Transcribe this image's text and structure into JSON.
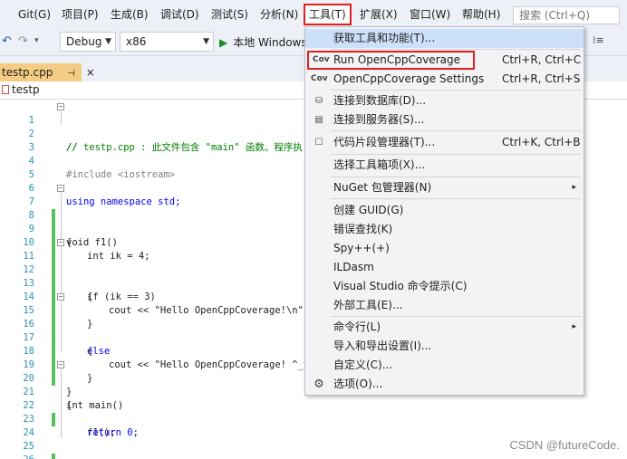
{
  "menubar": {
    "items": [
      "Git(G)",
      "项目(P)",
      "生成(B)",
      "调试(D)",
      "测试(S)",
      "分析(N)",
      "工具(T)",
      "扩展(X)",
      "窗口(W)",
      "帮助(H)"
    ],
    "search_placeholder": "搜索 (Ctrl+Q)"
  },
  "toolbar": {
    "config": "Debug",
    "platform": "x86",
    "run_label": "本地 Windows",
    "right_glyph": "⁞≡"
  },
  "tab": {
    "filename": "testp.cpp",
    "pin": "⊣",
    "close": "×"
  },
  "navbar": {
    "project": "testp"
  },
  "editor": {
    "lines": [
      {
        "n": "1",
        "text": "// testp.cpp : 此文件包含 \"main\" 函数。程序执"
      },
      {
        "n": "2",
        "text": "//"
      },
      {
        "n": "3",
        "text": ""
      },
      {
        "n": "4",
        "text": "#include <iostream>"
      },
      {
        "n": "5",
        "text": ""
      },
      {
        "n": "6",
        "text": "using namespace std;"
      },
      {
        "n": "7",
        "text": "void f1()"
      },
      {
        "n": "8",
        "text": "{"
      },
      {
        "n": "9",
        "text": "int ik = 4;"
      },
      {
        "n": "10",
        "text": ""
      },
      {
        "n": "11",
        "text": "if (ik == 3)"
      },
      {
        "n": "12",
        "text": "{"
      },
      {
        "n": "13",
        "text": "cout << \"Hello OpenCppCoverage!\\n\";"
      },
      {
        "n": "14",
        "text": "}"
      },
      {
        "n": "15",
        "text": "else"
      },
      {
        "n": "16",
        "text": "{"
      },
      {
        "n": "17",
        "text": "cout << \"Hello OpenCppCoverage! ^_^\\n"
      },
      {
        "n": "18",
        "text": "}"
      },
      {
        "n": "19",
        "text": "}"
      },
      {
        "n": "20",
        "text": "int main()"
      },
      {
        "n": "21",
        "text": "{"
      },
      {
        "n": "22",
        "text": "f1();"
      },
      {
        "n": "23",
        "text": "return 0;"
      },
      {
        "n": "24",
        "text": ""
      },
      {
        "n": "25",
        "text": "}"
      },
      {
        "n": "26",
        "text": ""
      }
    ]
  },
  "tools_menu": {
    "items": [
      {
        "label": "获取工具和功能(T)...",
        "shortcut": "",
        "icon": ""
      },
      {
        "label": "Run OpenCppCoverage",
        "shortcut": "Ctrl+R, Ctrl+C",
        "icon": "Cov"
      },
      {
        "label": "OpenCppCoverage Settings",
        "shortcut": "Ctrl+R, Ctrl+S",
        "icon": "Cov"
      },
      {
        "label": "连接到数据库(D)...",
        "shortcut": "",
        "icon": "db-icon"
      },
      {
        "label": "连接到服务器(S)...",
        "shortcut": "",
        "icon": "server-icon"
      },
      {
        "label": "代码片段管理器(T)...",
        "shortcut": "Ctrl+K, Ctrl+B",
        "icon": "snippet-icon"
      },
      {
        "label": "选择工具箱项(X)...",
        "shortcut": "",
        "icon": ""
      },
      {
        "label": "NuGet 包管理器(N)",
        "shortcut": "",
        "icon": "",
        "submenu": true
      },
      {
        "label": "创建 GUID(G)",
        "shortcut": "",
        "icon": ""
      },
      {
        "label": "错误查找(K)",
        "shortcut": "",
        "icon": ""
      },
      {
        "label": "Spy++(+)",
        "shortcut": "",
        "icon": ""
      },
      {
        "label": "ILDasm",
        "shortcut": "",
        "icon": ""
      },
      {
        "label": "Visual Studio 命令提示(C)",
        "shortcut": "",
        "icon": ""
      },
      {
        "label": "外部工具(E)...",
        "shortcut": "",
        "icon": ""
      },
      {
        "label": "命令行(L)",
        "shortcut": "",
        "icon": "",
        "submenu": true
      },
      {
        "label": "导入和导出设置(I)...",
        "shortcut": "",
        "icon": ""
      },
      {
        "label": "自定义(C)...",
        "shortcut": "",
        "icon": ""
      },
      {
        "label": "选项(O)...",
        "shortcut": "",
        "icon": "gear-icon"
      }
    ],
    "submenu_arrow": "▸"
  },
  "watermark": "CSDN @futureCode."
}
